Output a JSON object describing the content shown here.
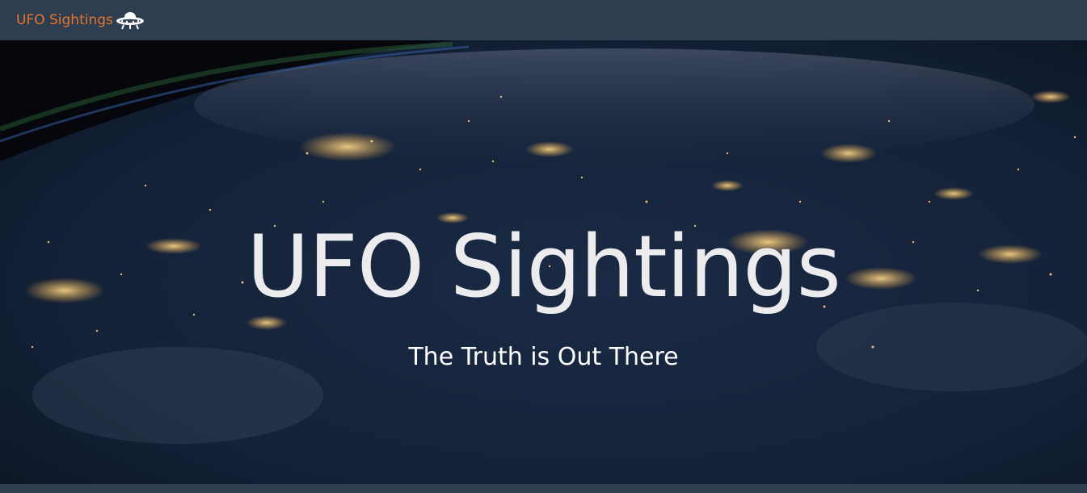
{
  "navbar": {
    "brand_label": "UFO Sightings",
    "brand_icon": "ufo-icon",
    "brand_color": "#e8742e",
    "background_color": "#2c3e50"
  },
  "hero": {
    "title": "UFO Sightings",
    "subtitle": "The Truth is Out There",
    "background_image": "earth-at-night-from-space"
  }
}
